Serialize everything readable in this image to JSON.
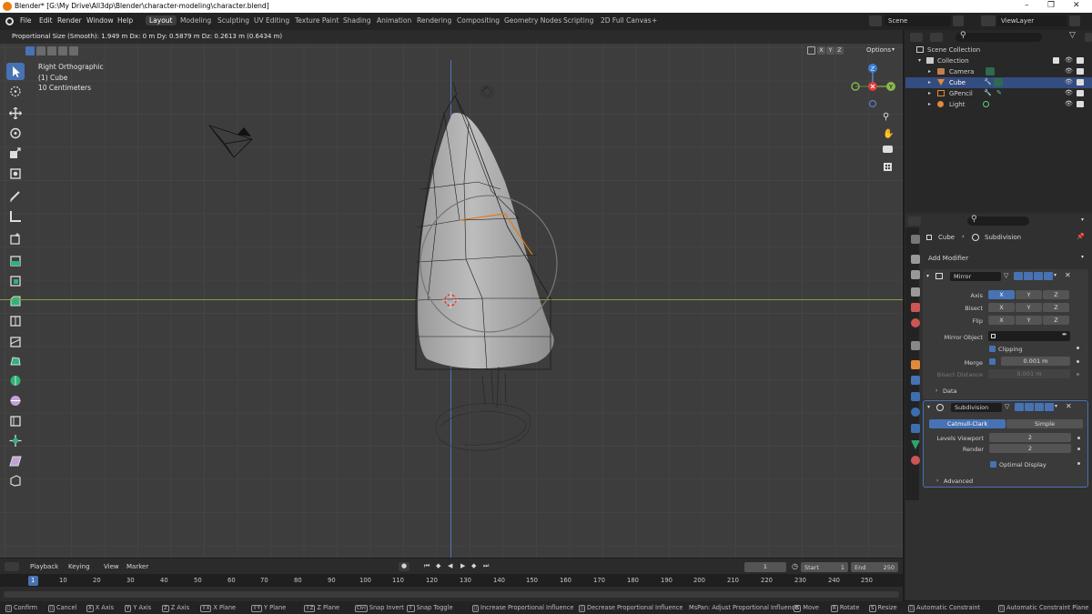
{
  "window": {
    "title": "Blender* [G:\\My Drive\\All3dp\\Blender\\character-modeling\\character.blend]",
    "controls": [
      "–",
      "❐",
      "✕"
    ]
  },
  "menubar": {
    "menus": [
      "File",
      "Edit",
      "Render",
      "Window",
      "Help"
    ],
    "workspaces": [
      "Layout",
      "Modeling",
      "Sculpting",
      "UV Editing",
      "Texture Paint",
      "Shading",
      "Animation",
      "Rendering",
      "Compositing",
      "Geometry Nodes",
      "Scripting",
      "2D Full Canvas",
      "+"
    ],
    "active_workspace": "Layout",
    "scene": "Scene",
    "view_layer": "ViewLayer"
  },
  "viewport_header": {
    "status": "Proportional Size (Smooth): 1.949 m  Dx: 0 m  Dy: 0.5879 m  Dz: 0.2613 m (0.6434 m)",
    "options_label": "Options",
    "axes": [
      "X",
      "Y",
      "Z"
    ]
  },
  "viewport": {
    "view_name": "Right Orthographic",
    "object": "(1) Cube",
    "scale": "10 Centimeters",
    "gizmo": {
      "z": "Z",
      "y": "Y"
    }
  },
  "outliner": {
    "root": "Scene Collection",
    "collection": "Collection",
    "items": [
      {
        "label": "Camera",
        "selected": false,
        "color": "#c27f4f"
      },
      {
        "label": "Cube",
        "selected": true,
        "color": "#e08a3c"
      },
      {
        "label": "GPencil",
        "selected": false,
        "color": "#e08a3c"
      },
      {
        "label": "Light",
        "selected": false,
        "color": "#e08a3c"
      }
    ]
  },
  "properties": {
    "breadcrumb_object": "Cube",
    "breadcrumb_modifier": "Subdivision",
    "add_modifier": "Add Modifier",
    "mirror": {
      "name": "Mirror",
      "axis_label": "Axis",
      "bisect_label": "Bisect",
      "flip_label": "Flip",
      "xyz": [
        "X",
        "Y",
        "Z"
      ],
      "mirror_object_label": "Mirror Object",
      "clipping_label": "Clipping",
      "merge_label": "Merge",
      "merge_value": "0.001 m",
      "bisect_distance_label": "Bisect Distance",
      "bisect_distance_value": "0.001 m",
      "data_label": "Data"
    },
    "subdivision": {
      "name": "Subdivision",
      "catmull": "Catmull-Clark",
      "simple": "Simple",
      "levels_viewport_label": "Levels Viewport",
      "levels_viewport_value": "2",
      "render_label": "Render",
      "render_value": "2",
      "optimal_display_label": "Optimal Display",
      "advanced_label": "Advanced"
    }
  },
  "timeline": {
    "menus": [
      "Playback",
      "Keying",
      "View",
      "Marker"
    ],
    "current_frame": "1",
    "start_label": "Start",
    "start_value": "1",
    "end_label": "End",
    "end_value": "250",
    "ruler_ticks": [
      "1",
      "10",
      "20",
      "30",
      "40",
      "50",
      "60",
      "70",
      "80",
      "90",
      "100",
      "110",
      "120",
      "130",
      "140",
      "150",
      "160",
      "170",
      "180",
      "190",
      "200",
      "210",
      "220",
      "230",
      "240",
      "250"
    ]
  },
  "statusbar": {
    "items": [
      {
        "key": "",
        "text": "Confirm"
      },
      {
        "key": "",
        "text": "Cancel"
      },
      {
        "key": "X",
        "text": "X Axis"
      },
      {
        "key": "Y",
        "text": "Y Axis"
      },
      {
        "key": "Z",
        "text": "Z Axis"
      },
      {
        "key": "⇧X",
        "text": "X Plane"
      },
      {
        "key": "⇧Y",
        "text": "Y Plane"
      },
      {
        "key": "⇧Z",
        "text": "Z Plane"
      },
      {
        "key": "Ctrl",
        "text": "Snap Invert"
      },
      {
        "key": "⇧",
        "text": "Snap Toggle"
      },
      {
        "key": "",
        "text": "Increase Proportional Influence"
      },
      {
        "key": "",
        "text": "Decrease Proportional Influence"
      },
      {
        "key": "",
        "text": "MsPan: Adjust Proportional Influence"
      },
      {
        "key": "G",
        "text": "Move"
      },
      {
        "key": "R",
        "text": "Rotate"
      },
      {
        "key": "S",
        "text": "Resize"
      },
      {
        "key": "",
        "text": "Automatic Constraint"
      },
      {
        "key": "",
        "text": "Automatic Constraint Plane"
      }
    ]
  }
}
